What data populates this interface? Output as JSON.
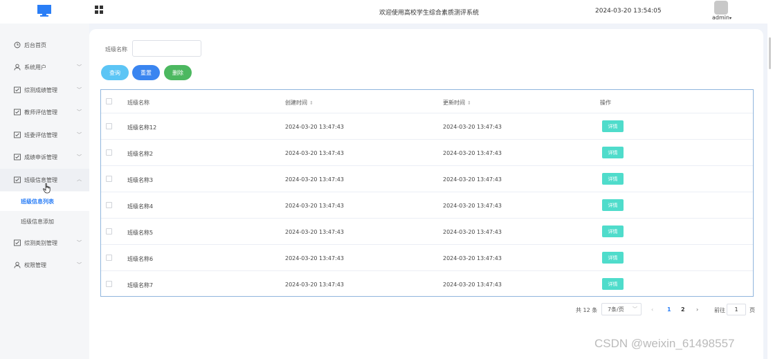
{
  "header": {
    "title": "欢迎使用高校学生综合素质测评系统",
    "datetime": "2024-03-20 13:54:05",
    "user": "admin",
    "logo_icon": "monitor-icon",
    "apps_icon": "grid-icon"
  },
  "sidebar": {
    "items": [
      {
        "label": "后台首页",
        "icon": "clock-icon"
      },
      {
        "label": "系统用户",
        "icon": "user-icon"
      },
      {
        "label": "综测成绩管理",
        "icon": "form-icon"
      },
      {
        "label": "教师评估管理",
        "icon": "form-icon"
      },
      {
        "label": "班委评估管理",
        "icon": "form-icon"
      },
      {
        "label": "成绩申诉管理",
        "icon": "form-icon"
      },
      {
        "label": "班级信息管理",
        "icon": "form-icon"
      },
      {
        "label": "综测类别管理",
        "icon": "form-icon"
      },
      {
        "label": "权限管理",
        "icon": "user-icon"
      }
    ],
    "sub_items": [
      {
        "label": "班级信息列表"
      },
      {
        "label": "班级信息添加"
      }
    ]
  },
  "filter": {
    "label": "班级名称",
    "value": "",
    "placeholder": ""
  },
  "buttons": {
    "search": "查询",
    "reset": "重置",
    "delete": "删除"
  },
  "table": {
    "headers": {
      "name": "班级名称",
      "created": "创建时间",
      "updated": "更新时间",
      "actions": "操作"
    },
    "rows": [
      {
        "name": "班级名称12",
        "created": "2024-03-20 13:47:43",
        "updated": "2024-03-20 13:47:43",
        "action": "详情"
      },
      {
        "name": "班级名称2",
        "created": "2024-03-20 13:47:43",
        "updated": "2024-03-20 13:47:43",
        "action": "详情"
      },
      {
        "name": "班级名称3",
        "created": "2024-03-20 13:47:43",
        "updated": "2024-03-20 13:47:43",
        "action": "详情"
      },
      {
        "name": "班级名称4",
        "created": "2024-03-20 13:47:43",
        "updated": "2024-03-20 13:47:43",
        "action": "详情"
      },
      {
        "name": "班级名称5",
        "created": "2024-03-20 13:47:43",
        "updated": "2024-03-20 13:47:43",
        "action": "详情"
      },
      {
        "name": "班级名称6",
        "created": "2024-03-20 13:47:43",
        "updated": "2024-03-20 13:47:43",
        "action": "详情"
      },
      {
        "name": "班级名称7",
        "created": "2024-03-20 13:47:43",
        "updated": "2024-03-20 13:47:43",
        "action": "详情"
      }
    ]
  },
  "pagination": {
    "total": "共 12 条",
    "page_size": "7条/页",
    "page1": "1",
    "page2": "2",
    "goto": "前往",
    "jump_value": "1",
    "page_suffix": "页"
  },
  "watermark": "CSDN @weixin_61498557",
  "colors": {
    "accent": "#2a7ef6",
    "search_btn": "#5cc5f5",
    "reset_btn": "#3a85f0",
    "delete_btn": "#4cb860",
    "detail_btn": "#4fdccb"
  }
}
